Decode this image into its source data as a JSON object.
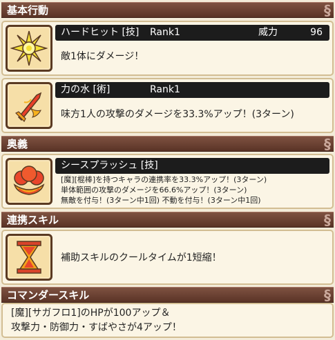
{
  "sections": {
    "basic": "基本行動",
    "ougi": "奥義",
    "renkei": "連携スキル",
    "commander": "コマンダースキル"
  },
  "skills": {
    "hard_hit": {
      "name": "ハードヒット [技]",
      "rank": "Rank1",
      "power_label": "威力",
      "power": "96",
      "desc": "敵1体にダメージ！"
    },
    "power_water": {
      "name": "力の水 [術]",
      "rank": "Rank1",
      "desc": "味方1人の攻撃のダメージを33.3%アップ！(3ターン)"
    },
    "sea_splash": {
      "name": "シースプラッシュ [技]",
      "lines": [
        "[魔][棍棒]を持つキャラの連携率を33.3%アップ！(3ターン)",
        "単体範囲の攻撃のダメージを66.6%アップ！(3ターン)",
        "無敵を付与！(3ターン中1回) 不動を付与！(3ターン中1回)"
      ]
    },
    "renkei": {
      "desc": "補助スキルのクールタイムが1短縮！"
    }
  },
  "commander": {
    "line1": "[魔][サガフロ1]のHPが100アップ＆",
    "line2": "攻撃力・防御力・すばやさが4アップ！"
  },
  "icons": {
    "hard_hit": "starburst-icon",
    "power_water": "flaming-sword-icon",
    "sea_splash": "fire-orb-icon",
    "renkei": "hourglass-icon"
  }
}
